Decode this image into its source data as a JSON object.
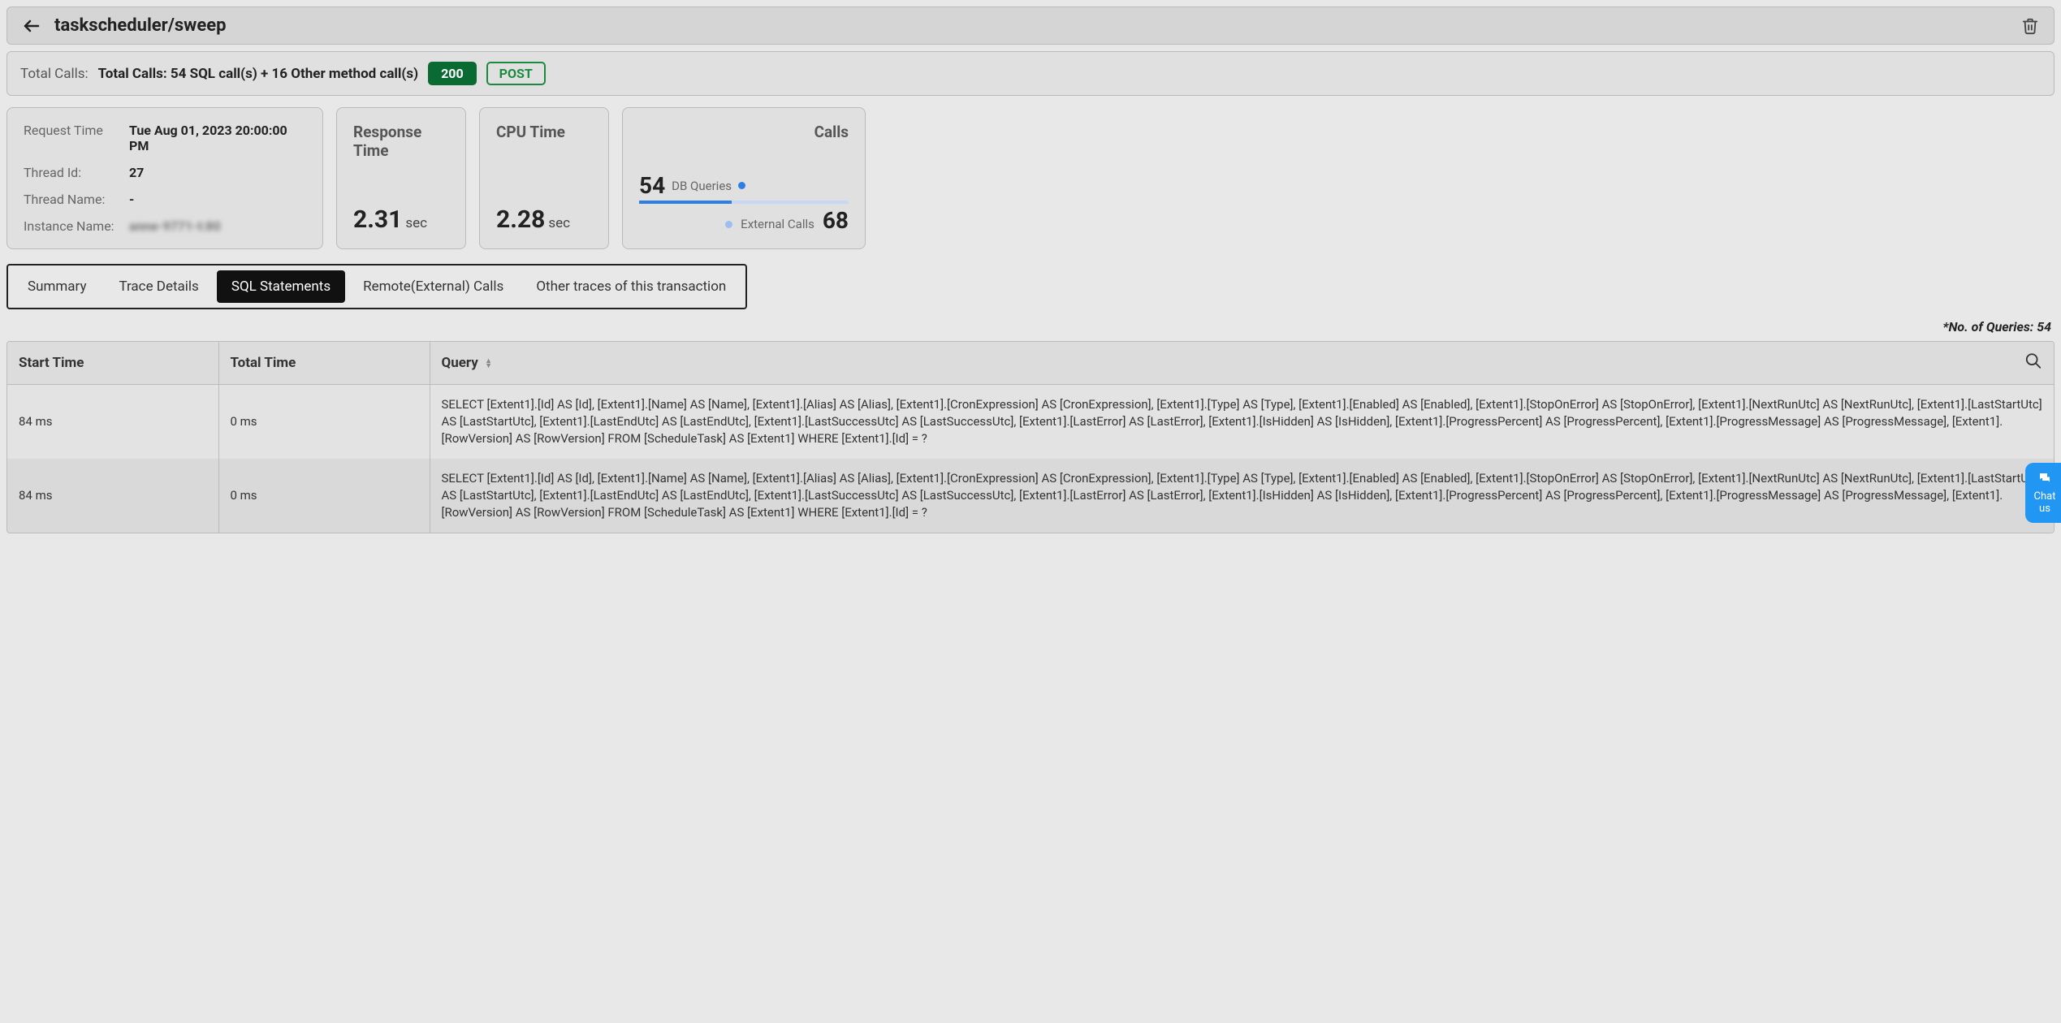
{
  "header": {
    "title": "taskscheduler/sweep"
  },
  "summary": {
    "label": "Total Calls:",
    "value": "Total Calls: 54 SQL call(s) + 16 Other method call(s)",
    "status_code": "200",
    "http_method": "POST"
  },
  "info": {
    "request_time_label": "Request Time",
    "request_time": "Tue Aug 01, 2023 20:00:00 PM",
    "thread_id_label": "Thread Id:",
    "thread_id": "27",
    "thread_name_label": "Thread Name:",
    "thread_name": "-",
    "instance_name_label": "Instance Name:",
    "instance_name": "anne-9771-t:80"
  },
  "metrics": {
    "response_time_label": "Response Time",
    "response_time": "2.31",
    "response_unit": "sec",
    "cpu_time_label": "CPU Time",
    "cpu_time": "2.28",
    "cpu_unit": "sec"
  },
  "calls": {
    "title": "Calls",
    "db_value": "54",
    "db_label": "DB Queries",
    "ext_label": "External Calls",
    "ext_value": "68"
  },
  "tabs": [
    {
      "label": "Summary",
      "active": false
    },
    {
      "label": "Trace Details",
      "active": false
    },
    {
      "label": "SQL Statements",
      "active": true
    },
    {
      "label": "Remote(External) Calls",
      "active": false
    },
    {
      "label": "Other traces of this transaction",
      "active": false
    }
  ],
  "queries_note": "*No. of Queries: 54",
  "table": {
    "headers": {
      "start": "Start Time",
      "total": "Total Time",
      "query": "Query"
    },
    "rows": [
      {
        "start": "84 ms",
        "total": "0 ms",
        "query": "SELECT [Extent1].[Id] AS [Id], [Extent1].[Name] AS [Name], [Extent1].[Alias] AS [Alias], [Extent1].[CronExpression] AS [CronExpression], [Extent1].[Type] AS [Type], [Extent1].[Enabled] AS [Enabled], [Extent1].[StopOnError] AS [StopOnError], [Extent1].[NextRunUtc] AS [NextRunUtc], [Extent1].[LastStartUtc] AS [LastStartUtc], [Extent1].[LastEndUtc] AS [LastEndUtc], [Extent1].[LastSuccessUtc] AS [LastSuccessUtc], [Extent1].[LastError] AS [LastError], [Extent1].[IsHidden] AS [IsHidden], [Extent1].[ProgressPercent] AS [ProgressPercent], [Extent1].[ProgressMessage] AS [ProgressMessage], [Extent1].[RowVersion] AS [RowVersion] FROM [ScheduleTask] AS [Extent1] WHERE [Extent1].[Id] = ?"
      },
      {
        "start": "84 ms",
        "total": "0 ms",
        "query": "SELECT [Extent1].[Id] AS [Id], [Extent1].[Name] AS [Name], [Extent1].[Alias] AS [Alias], [Extent1].[CronExpression] AS [CronExpression], [Extent1].[Type] AS [Type], [Extent1].[Enabled] AS [Enabled], [Extent1].[StopOnError] AS [StopOnError], [Extent1].[NextRunUtc] AS [NextRunUtc], [Extent1].[LastStartUtc] AS [LastStartUtc], [Extent1].[LastEndUtc] AS [LastEndUtc], [Extent1].[LastSuccessUtc] AS [LastSuccessUtc], [Extent1].[LastError] AS [LastError], [Extent1].[IsHidden] AS [IsHidden], [Extent1].[ProgressPercent] AS [ProgressPercent], [Extent1].[ProgressMessage] AS [ProgressMessage], [Extent1].[RowVersion] AS [RowVersion] FROM [ScheduleTask] AS [Extent1] WHERE [Extent1].[Id] = ?"
      }
    ]
  },
  "chat": {
    "label": "Chat us"
  }
}
